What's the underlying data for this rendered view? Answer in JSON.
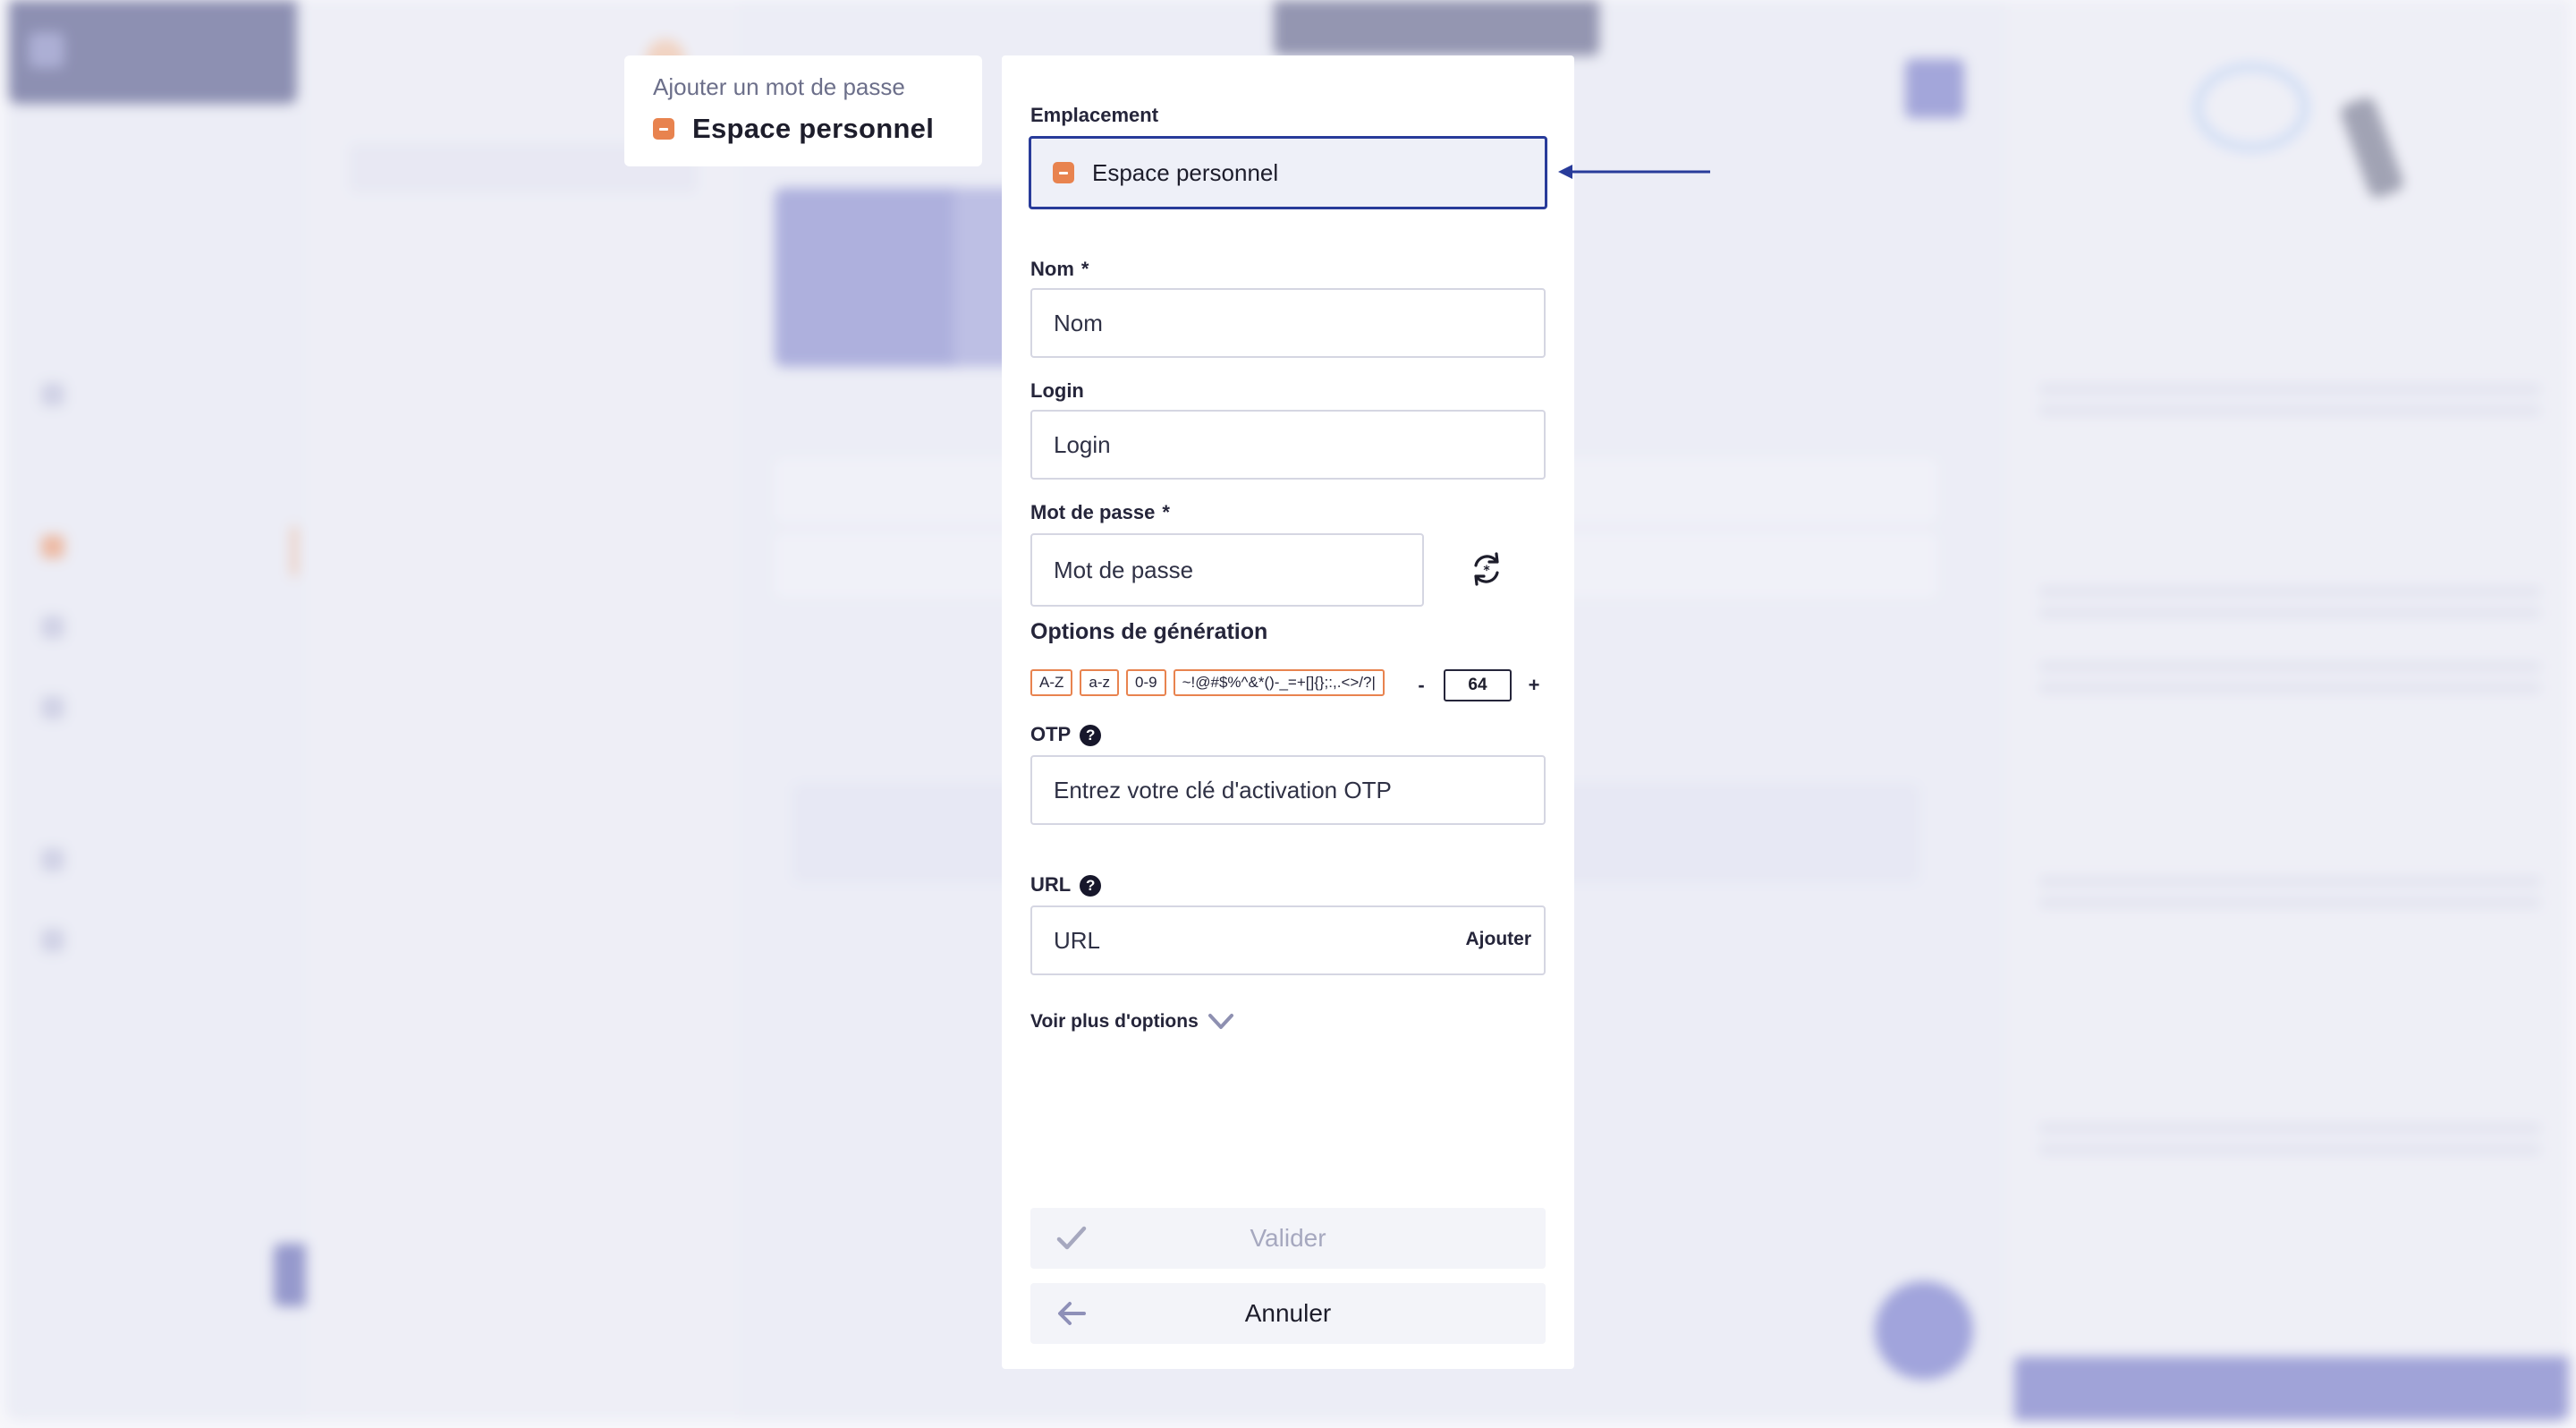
{
  "breadcrumb": {
    "title": "Ajouter un mot de passe",
    "location": "Espace personnel"
  },
  "form": {
    "location_label": "Emplacement",
    "location_value": "Espace personnel",
    "name_label": "Nom",
    "name_placeholder": "Nom",
    "login_label": "Login",
    "login_placeholder": "Login",
    "password_label": "Mot de passe",
    "password_placeholder": "Mot de passe",
    "required_mark": "*",
    "generation_title": "Options de génération",
    "chips": [
      "A-Z",
      "a-z",
      "0-9",
      "~!@#$%^&*()-_=+[]{};:,.<>/?|"
    ],
    "length_minus": "-",
    "length_value": "64",
    "length_plus": "+",
    "otp_label": "OTP",
    "otp_placeholder": "Entrez votre clé d'activation OTP",
    "url_label": "URL",
    "url_placeholder": "URL",
    "url_add": "Ajouter",
    "help_glyph": "?",
    "more_options": "Voir plus d'options",
    "validate": "Valider",
    "cancel": "Annuler"
  },
  "colors": {
    "accent_orange": "#e8834f",
    "focus_blue": "#283b9a",
    "brand_purple": "#7b80cf"
  },
  "icons": [
    "space-icon",
    "regenerate-icon",
    "help-icon",
    "chevron-down-icon",
    "check-icon",
    "arrow-left-icon",
    "pointer-arrow"
  ]
}
